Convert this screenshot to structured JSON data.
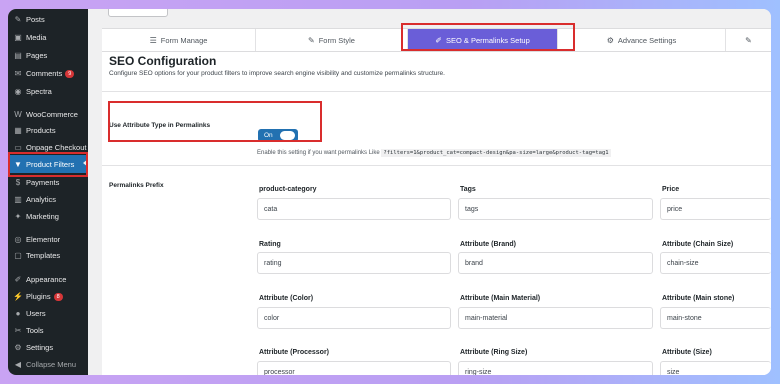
{
  "sidebar": {
    "items": [
      {
        "label": "Posts",
        "icon": "pin-icon"
      },
      {
        "label": "Media",
        "icon": "media-icon"
      },
      {
        "label": "Pages",
        "icon": "page-icon"
      },
      {
        "label": "Comments",
        "icon": "comment-icon",
        "badge": "9"
      },
      {
        "label": "Spectra",
        "icon": "spectra-icon"
      },
      {
        "label": "WooCommerce",
        "icon": "woocommerce-icon"
      },
      {
        "label": "Products",
        "icon": "products-icon"
      },
      {
        "label": "Onpage Checkout",
        "icon": "checkout-icon"
      },
      {
        "label": "Product Filters",
        "icon": "filter-icon",
        "active": true
      },
      {
        "label": "Payments",
        "icon": "payments-icon"
      },
      {
        "label": "Analytics",
        "icon": "analytics-icon"
      },
      {
        "label": "Marketing",
        "icon": "marketing-icon"
      },
      {
        "label": "Elementor",
        "icon": "elementor-icon"
      },
      {
        "label": "Templates",
        "icon": "templates-icon"
      },
      {
        "label": "Appearance",
        "icon": "appearance-icon"
      },
      {
        "label": "Plugins",
        "icon": "plugins-icon",
        "badge": "8"
      },
      {
        "label": "Users",
        "icon": "users-icon"
      },
      {
        "label": "Tools",
        "icon": "tools-icon"
      },
      {
        "label": "Settings",
        "icon": "settings-icon"
      },
      {
        "label": "Collapse Menu",
        "icon": "collapse-icon"
      }
    ]
  },
  "tabs": [
    {
      "label": "Form Manage",
      "icon": "sliders-icon"
    },
    {
      "label": "Form Style",
      "icon": "brush-icon"
    },
    {
      "label": "SEO & Permalinks Setup",
      "icon": "link-icon",
      "active": true
    },
    {
      "label": "Advance Settings",
      "icon": "gear-icon"
    }
  ],
  "seo": {
    "title": "SEO Configuration",
    "description": "Configure SEO options for your product filters to improve search engine visibility and customize permalinks structure.",
    "attribute_type_label": "Use Attribute Type in Permalinks",
    "toggle_text": "On",
    "hint_text": "Enable this setting if you want permalinks Like",
    "hint_code": "?filters=1&product_cat=compact-design&pa-size=large&product-tag=tag1",
    "prefix_label": "Permalinks Prefix"
  },
  "fields": [
    {
      "label": "product-category",
      "value": "cata"
    },
    {
      "label": "Tags",
      "value": "tags"
    },
    {
      "label": "Price",
      "value": "price"
    },
    {
      "label": "Rating",
      "value": "rating"
    },
    {
      "label": "Attribute (Brand)",
      "value": "brand"
    },
    {
      "label": "Attribute (Chain Size)",
      "value": "chain-size"
    },
    {
      "label": "Attribute (Color)",
      "value": "color"
    },
    {
      "label": "Attribute (Main Material)",
      "value": "main-material"
    },
    {
      "label": "Attribute (Main stone)",
      "value": "main-stone"
    },
    {
      "label": "Attribute (Processor)",
      "value": "processor"
    },
    {
      "label": "Attribute (Ring Size)",
      "value": "ring-size"
    },
    {
      "label": "Attribute (Size)",
      "value": "size"
    }
  ],
  "colors": {
    "sidebar_bg": "#1d2327",
    "active_menu": "#2271b1",
    "active_tab": "#6a5ed8",
    "highlight": "#d92d2d"
  }
}
